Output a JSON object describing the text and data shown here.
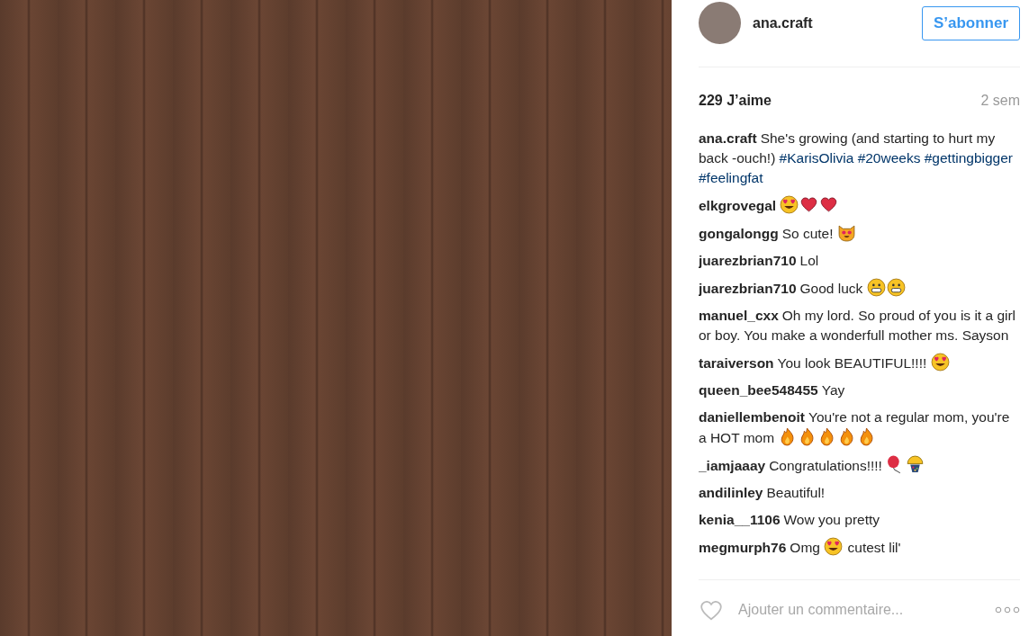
{
  "header": {
    "username": "ana.craft",
    "follow_button": "S’abonner"
  },
  "stats": {
    "likes": "229 J’aime",
    "time": "2 sem"
  },
  "comments": [
    {
      "user": "ana.craft",
      "parts": [
        {
          "kind": "text",
          "text": "She's growing (and starting to hurt my back -ouch!)"
        },
        {
          "kind": "tag",
          "text": "#KarisOlivia"
        },
        {
          "kind": "tag",
          "text": "#20weeks"
        },
        {
          "kind": "tag",
          "text": "#gettingbigger"
        },
        {
          "kind": "tag",
          "text": "#feelingfat"
        }
      ]
    },
    {
      "user": "elkgrovegal",
      "parts": [
        {
          "kind": "hearteyes"
        },
        {
          "kind": "heart"
        },
        {
          "kind": "heart"
        }
      ]
    },
    {
      "user": "gongalongg",
      "parts": [
        {
          "kind": "text",
          "text": "So cute!"
        },
        {
          "kind": "catface"
        }
      ]
    },
    {
      "user": "juarezbrian710",
      "parts": [
        {
          "kind": "text",
          "text": "Lol"
        }
      ]
    },
    {
      "user": "juarezbrian710",
      "parts": [
        {
          "kind": "text",
          "text": "Good luck"
        },
        {
          "kind": "grin"
        },
        {
          "kind": "grin"
        }
      ]
    },
    {
      "user": "manuel_cxx",
      "parts": [
        {
          "kind": "text",
          "text": "Oh my lord. So proud of you is it a girl or boy. You make a wonderfull mother ms. Sayson"
        }
      ]
    },
    {
      "user": "taraiverson",
      "parts": [
        {
          "kind": "text",
          "text": "You look BEAUTIFUL!!!!"
        },
        {
          "kind": "hearteyes"
        }
      ]
    },
    {
      "user": "queen_bee548455",
      "parts": [
        {
          "kind": "text",
          "text": "Yay"
        }
      ]
    },
    {
      "user": "daniellembenoit",
      "parts": [
        {
          "kind": "text",
          "text": "You're not a regular mom, you're a HOT mom"
        },
        {
          "kind": "fire"
        },
        {
          "kind": "fire"
        },
        {
          "kind": "fire"
        },
        {
          "kind": "fire"
        },
        {
          "kind": "fire"
        }
      ]
    },
    {
      "user": "_iamjaaay",
      "parts": [
        {
          "kind": "text",
          "text": "Congratulations!!!!"
        },
        {
          "kind": "balloon"
        },
        {
          "kind": "confetti"
        }
      ]
    },
    {
      "user": "andilinley",
      "parts": [
        {
          "kind": "text",
          "text": "Beautiful!"
        }
      ]
    },
    {
      "user": "kenia__1106",
      "parts": [
        {
          "kind": "text",
          "text": "Wow you pretty"
        }
      ]
    },
    {
      "user": "megmurph76",
      "parts": [
        {
          "kind": "text",
          "text": "Omg"
        },
        {
          "kind": "hearteyes"
        },
        {
          "kind": "text",
          "text": "cutest lil'"
        }
      ]
    }
  ],
  "footer": {
    "placeholder": "Ajouter un commentaire..."
  }
}
